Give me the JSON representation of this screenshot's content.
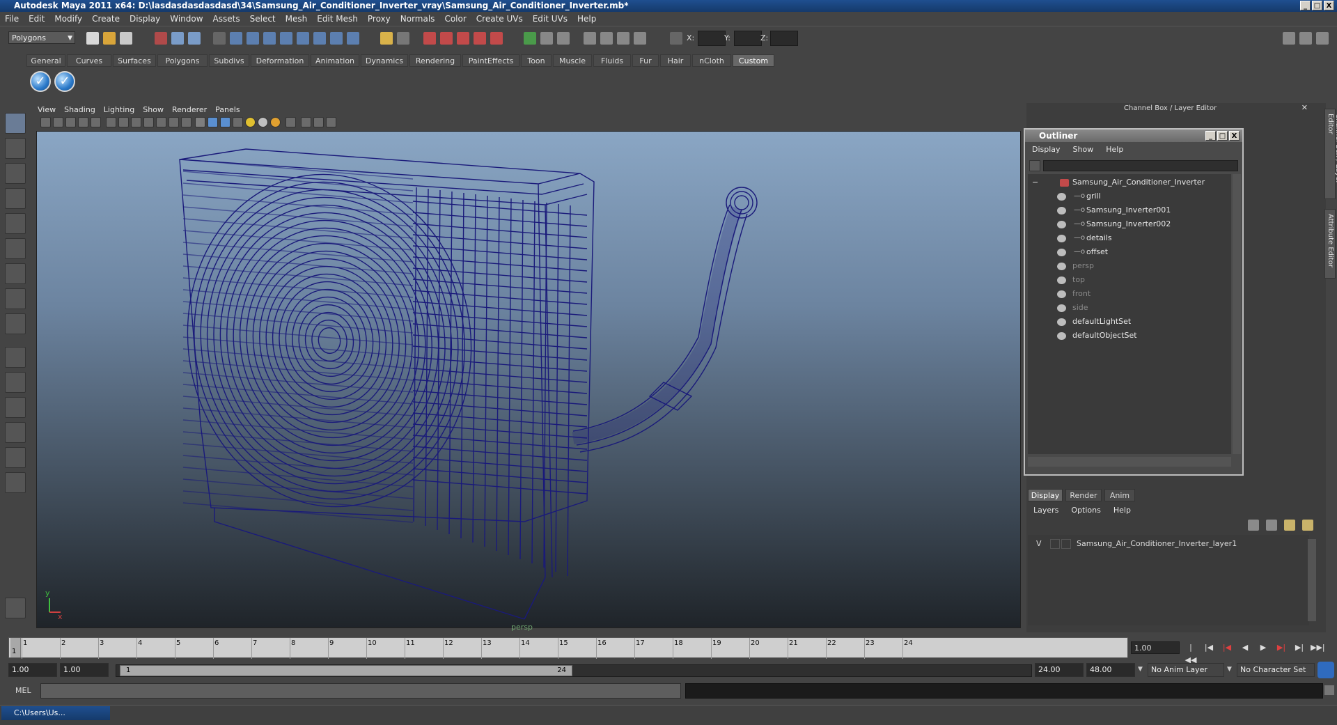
{
  "app": {
    "title": "Autodesk Maya 2011 x64: D:\\lasdasdasdasdasd\\34\\Samsung_Air_Conditioner_Inverter_vray\\Samsung_Air_Conditioner_Inverter.mb*",
    "min": "_",
    "max": "□",
    "close": "X"
  },
  "menu": [
    "File",
    "Edit",
    "Modify",
    "Create",
    "Display",
    "Window",
    "Assets",
    "Select",
    "Mesh",
    "Edit Mesh",
    "Proxy",
    "Normals",
    "Color",
    "Create UVs",
    "Edit UVs",
    "Help"
  ],
  "status": {
    "mode": "Polygons",
    "x_label": "X:",
    "y_label": "Y:",
    "z_label": "Z:"
  },
  "shelf": {
    "tabs": [
      "General",
      "Curves",
      "Surfaces",
      "Polygons",
      "Subdivs",
      "Deformation",
      "Animation",
      "Dynamics",
      "Rendering",
      "PaintEffects",
      "Toon",
      "Muscle",
      "Fluids",
      "Fur",
      "Hair",
      "nCloth",
      "Custom"
    ],
    "active_tab": "Custom"
  },
  "viewport": {
    "menu": [
      "View",
      "Shading",
      "Lighting",
      "Show",
      "Renderer",
      "Panels"
    ],
    "camera": "persp",
    "axis_y": "y",
    "axis_x": "x",
    "wire_color": "#1a1a7a"
  },
  "channel_box": {
    "header": "Channel Box / Layer Editor"
  },
  "outliner": {
    "title": "Outliner",
    "menu": [
      "Display",
      "Show",
      "Help"
    ],
    "items": [
      {
        "label": "Samsung_Air_Conditioner_Inverter",
        "indent": 0,
        "dim": false,
        "root": true
      },
      {
        "label": "grill",
        "indent": 1,
        "dim": false
      },
      {
        "label": "Samsung_Inverter001",
        "indent": 1,
        "dim": false
      },
      {
        "label": "Samsung_Inverter002",
        "indent": 1,
        "dim": false
      },
      {
        "label": "details",
        "indent": 1,
        "dim": false
      },
      {
        "label": "offset",
        "indent": 1,
        "dim": false
      },
      {
        "label": "persp",
        "indent": 0,
        "dim": true
      },
      {
        "label": "top",
        "indent": 0,
        "dim": true
      },
      {
        "label": "front",
        "indent": 0,
        "dim": true
      },
      {
        "label": "side",
        "indent": 0,
        "dim": true
      },
      {
        "label": "defaultLightSet",
        "indent": 0,
        "dim": false
      },
      {
        "label": "defaultObjectSet",
        "indent": 0,
        "dim": false
      }
    ]
  },
  "layer_editor": {
    "tabs": [
      "Display",
      "Render",
      "Anim"
    ],
    "active_tab": "Display",
    "menu": [
      "Layers",
      "Options",
      "Help"
    ],
    "layer": {
      "visible": "V",
      "name": "Samsung_Air_Conditioner_Inverter_layer1"
    }
  },
  "side_tabs": [
    "Channel Box / Layer Editor",
    "Attribute Editor"
  ],
  "timeline": {
    "frames": [
      "1",
      "2",
      "3",
      "4",
      "5",
      "6",
      "7",
      "8",
      "9",
      "10",
      "11",
      "12",
      "13",
      "14",
      "15",
      "16",
      "17",
      "18",
      "19",
      "20",
      "21",
      "22",
      "23",
      "24"
    ],
    "current_frame": "1.00",
    "current_marker": "1"
  },
  "range": {
    "start": "1.00",
    "playback_start": "1.00",
    "slider_start": "1",
    "slider_end": "24",
    "playback_end": "24.00",
    "end": "48.00",
    "anim_layer": "No Anim Layer",
    "character_set": "No Character Set"
  },
  "command": {
    "label": "MEL"
  },
  "taskbar": {
    "minimized": "C:\\Users\\Us..."
  }
}
